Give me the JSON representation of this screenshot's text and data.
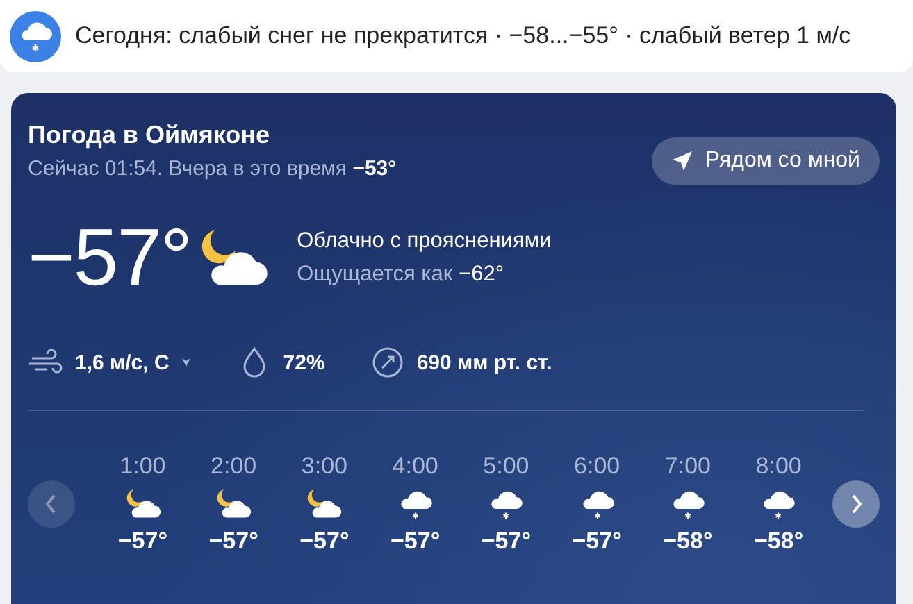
{
  "alert": {
    "text": "Сегодня: слабый снег не прекратится · −58...−55° · слабый ветер 1 м/с"
  },
  "card": {
    "title": "Погода в Оймяконе",
    "subtitle": "Сейчас 01:54. Вчера в это время",
    "yesterday_temp": "−53°",
    "nearby_button": "Рядом со мной",
    "temperature": "−57°",
    "condition": "Облачно с прояснениями",
    "feels_label": "Ощущается как",
    "feels_temp": "−62°",
    "wind": "1,6 м/с, С",
    "humidity": "72%",
    "pressure": "690 мм рт. ст.",
    "prev_disabled": true,
    "next_disabled": false,
    "hours": [
      {
        "time": "1:00",
        "kind": "night-cloud",
        "temp": "−57°"
      },
      {
        "time": "2:00",
        "kind": "night-cloud",
        "temp": "−57°"
      },
      {
        "time": "3:00",
        "kind": "night-cloud",
        "temp": "−57°"
      },
      {
        "time": "4:00",
        "kind": "snow",
        "temp": "−57°"
      },
      {
        "time": "5:00",
        "kind": "snow",
        "temp": "−57°"
      },
      {
        "time": "6:00",
        "kind": "snow",
        "temp": "−57°"
      },
      {
        "time": "7:00",
        "kind": "snow",
        "temp": "−58°"
      },
      {
        "time": "8:00",
        "kind": "snow",
        "temp": "−58°"
      }
    ]
  }
}
